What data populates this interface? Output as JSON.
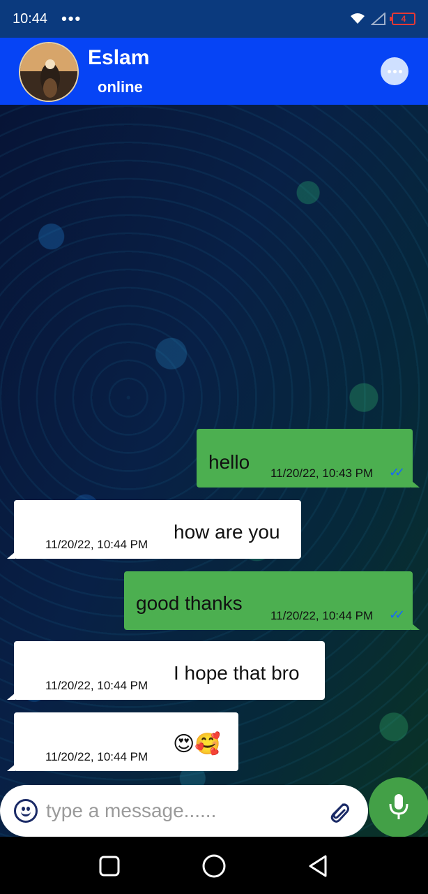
{
  "status_bar": {
    "time": "10:44",
    "dots": "•••",
    "battery": "4"
  },
  "header": {
    "contact_name": "Eslam",
    "status": "online"
  },
  "messages": [
    {
      "direction": "outgoing",
      "text": "hello",
      "time": "11/20/22, 10:43 PM",
      "read": true
    },
    {
      "direction": "incoming",
      "text": "how are you",
      "time": "11/20/22, 10:44 PM"
    },
    {
      "direction": "outgoing",
      "text": "good thanks",
      "time": "11/20/22, 10:44 PM",
      "read": true
    },
    {
      "direction": "incoming",
      "text": "I hope that bro",
      "time": "11/20/22, 10:44 PM"
    },
    {
      "direction": "incoming",
      "text": "😍🥰",
      "time": "11/20/22, 10:44 PM"
    }
  ],
  "composer": {
    "placeholder": "type a message......"
  },
  "colors": {
    "header": "#0644f5",
    "status_bar": "#0b3a7e",
    "outgoing_bubble": "#4caf50",
    "incoming_bubble": "#ffffff",
    "mic_button": "#43a047",
    "read_ticks": "#1565ff"
  }
}
